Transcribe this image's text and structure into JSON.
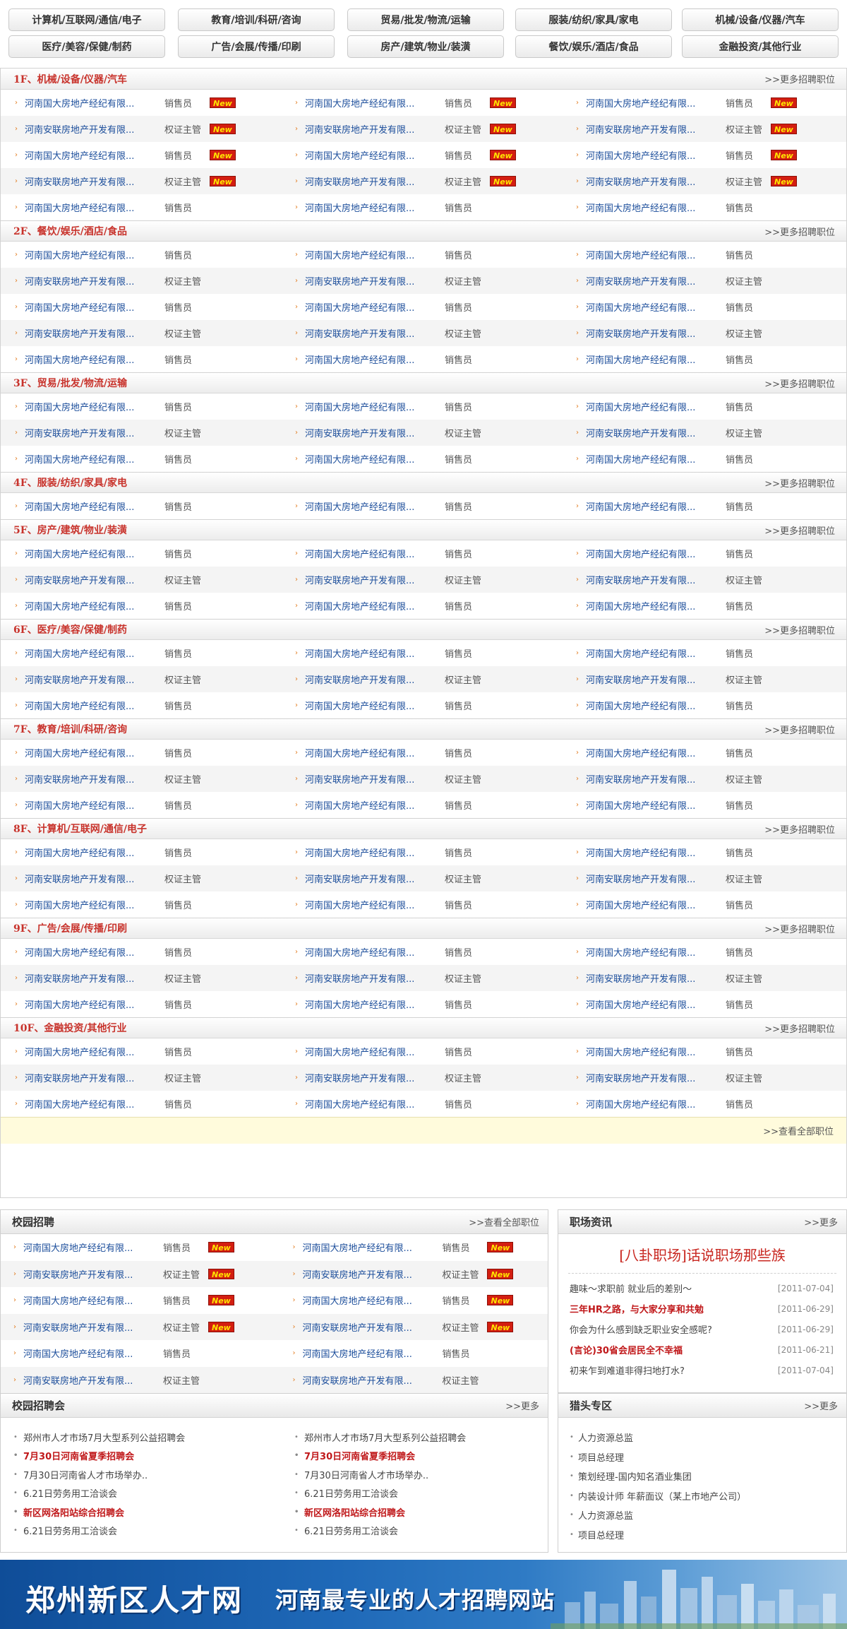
{
  "categories": [
    "计算机/互联网/通信/电子",
    "教育/培训/科研/咨询",
    "贸易/批发/物流/运输",
    "服装/纺织/家具/家电",
    "机械/设备/仪器/汽车",
    "医疗/美容/保健/制药",
    "广告/会展/传播/印刷",
    "房产/建筑/物业/装潢",
    "餐饮/娱乐/酒店/食品",
    "金融投资/其他行业"
  ],
  "labels": {
    "more_jobs": ">>更多招聘职位",
    "view_all_jobs": ">>查看全部职位",
    "view_all_campus": ">>查看全部职位",
    "more": ">>更多",
    "new_badge": "New",
    "arrow_glyph": "›",
    "dot_glyph": "•"
  },
  "floors": [
    {
      "title": "1F、机械/设备/仪器/汽车",
      "rows": [
        [
          {
            "company": "河南国大房地产经纪有限...",
            "position": "销售员",
            "new": true
          },
          {
            "company": "河南国大房地产经纪有限...",
            "position": "销售员",
            "new": true
          },
          {
            "company": "河南国大房地产经纪有限...",
            "position": "销售员",
            "new": true
          }
        ],
        [
          {
            "company": "河南安联房地产开发有限...",
            "position": "权证主管",
            "new": true
          },
          {
            "company": "河南安联房地产开发有限...",
            "position": "权证主管",
            "new": true
          },
          {
            "company": "河南安联房地产开发有限...",
            "position": "权证主管",
            "new": true
          }
        ],
        [
          {
            "company": "河南国大房地产经纪有限...",
            "position": "销售员",
            "new": true
          },
          {
            "company": "河南国大房地产经纪有限...",
            "position": "销售员",
            "new": true
          },
          {
            "company": "河南国大房地产经纪有限...",
            "position": "销售员",
            "new": true
          }
        ],
        [
          {
            "company": "河南安联房地产开发有限...",
            "position": "权证主管",
            "new": true
          },
          {
            "company": "河南安联房地产开发有限...",
            "position": "权证主管",
            "new": true
          },
          {
            "company": "河南安联房地产开发有限...",
            "position": "权证主管",
            "new": true
          }
        ],
        [
          {
            "company": "河南国大房地产经纪有限...",
            "position": "销售员",
            "new": false
          },
          {
            "company": "河南国大房地产经纪有限...",
            "position": "销售员",
            "new": false
          },
          {
            "company": "河南国大房地产经纪有限...",
            "position": "销售员",
            "new": false
          }
        ]
      ]
    },
    {
      "title": "2F、餐饮/娱乐/酒店/食品",
      "rows": [
        [
          {
            "company": "河南国大房地产经纪有限...",
            "position": "销售员",
            "new": false
          },
          {
            "company": "河南国大房地产经纪有限...",
            "position": "销售员",
            "new": false
          },
          {
            "company": "河南国大房地产经纪有限...",
            "position": "销售员",
            "new": false
          }
        ],
        [
          {
            "company": "河南安联房地产开发有限...",
            "position": "权证主管",
            "new": false
          },
          {
            "company": "河南安联房地产开发有限...",
            "position": "权证主管",
            "new": false
          },
          {
            "company": "河南安联房地产开发有限...",
            "position": "权证主管",
            "new": false
          }
        ],
        [
          {
            "company": "河南国大房地产经纪有限...",
            "position": "销售员",
            "new": false
          },
          {
            "company": "河南国大房地产经纪有限...",
            "position": "销售员",
            "new": false
          },
          {
            "company": "河南国大房地产经纪有限...",
            "position": "销售员",
            "new": false
          }
        ],
        [
          {
            "company": "河南安联房地产开发有限...",
            "position": "权证主管",
            "new": false
          },
          {
            "company": "河南安联房地产开发有限...",
            "position": "权证主管",
            "new": false
          },
          {
            "company": "河南安联房地产开发有限...",
            "position": "权证主管",
            "new": false
          }
        ],
        [
          {
            "company": "河南国大房地产经纪有限...",
            "position": "销售员",
            "new": false
          },
          {
            "company": "河南国大房地产经纪有限...",
            "position": "销售员",
            "new": false
          },
          {
            "company": "河南国大房地产经纪有限...",
            "position": "销售员",
            "new": false
          }
        ]
      ]
    },
    {
      "title": "3F、贸易/批发/物流/运输",
      "rows": [
        [
          {
            "company": "河南国大房地产经纪有限...",
            "position": "销售员",
            "new": false
          },
          {
            "company": "河南国大房地产经纪有限...",
            "position": "销售员",
            "new": false
          },
          {
            "company": "河南国大房地产经纪有限...",
            "position": "销售员",
            "new": false
          }
        ],
        [
          {
            "company": "河南安联房地产开发有限...",
            "position": "权证主管",
            "new": false
          },
          {
            "company": "河南安联房地产开发有限...",
            "position": "权证主管",
            "new": false
          },
          {
            "company": "河南安联房地产开发有限...",
            "position": "权证主管",
            "new": false
          }
        ],
        [
          {
            "company": "河南国大房地产经纪有限...",
            "position": "销售员",
            "new": false
          },
          {
            "company": "河南国大房地产经纪有限...",
            "position": "销售员",
            "new": false
          },
          {
            "company": "河南国大房地产经纪有限...",
            "position": "销售员",
            "new": false
          }
        ]
      ]
    },
    {
      "title": "4F、服装/纺织/家具/家电",
      "rows": [
        [
          {
            "company": "河南国大房地产经纪有限...",
            "position": "销售员",
            "new": false
          },
          {
            "company": "河南国大房地产经纪有限...",
            "position": "销售员",
            "new": false
          },
          {
            "company": "河南国大房地产经纪有限...",
            "position": "销售员",
            "new": false
          }
        ]
      ]
    },
    {
      "title": "5F、房产/建筑/物业/装潢",
      "rows": [
        [
          {
            "company": "河南国大房地产经纪有限...",
            "position": "销售员",
            "new": false
          },
          {
            "company": "河南国大房地产经纪有限...",
            "position": "销售员",
            "new": false
          },
          {
            "company": "河南国大房地产经纪有限...",
            "position": "销售员",
            "new": false
          }
        ],
        [
          {
            "company": "河南安联房地产开发有限...",
            "position": "权证主管",
            "new": false
          },
          {
            "company": "河南安联房地产开发有限...",
            "position": "权证主管",
            "new": false
          },
          {
            "company": "河南安联房地产开发有限...",
            "position": "权证主管",
            "new": false
          }
        ],
        [
          {
            "company": "河南国大房地产经纪有限...",
            "position": "销售员",
            "new": false
          },
          {
            "company": "河南国大房地产经纪有限...",
            "position": "销售员",
            "new": false
          },
          {
            "company": "河南国大房地产经纪有限...",
            "position": "销售员",
            "new": false
          }
        ]
      ]
    },
    {
      "title": "6F、医疗/美容/保健/制药",
      "rows": [
        [
          {
            "company": "河南国大房地产经纪有限...",
            "position": "销售员",
            "new": false
          },
          {
            "company": "河南国大房地产经纪有限...",
            "position": "销售员",
            "new": false
          },
          {
            "company": "河南国大房地产经纪有限...",
            "position": "销售员",
            "new": false
          }
        ],
        [
          {
            "company": "河南安联房地产开发有限...",
            "position": "权证主管",
            "new": false
          },
          {
            "company": "河南安联房地产开发有限...",
            "position": "权证主管",
            "new": false
          },
          {
            "company": "河南安联房地产开发有限...",
            "position": "权证主管",
            "new": false
          }
        ],
        [
          {
            "company": "河南国大房地产经纪有限...",
            "position": "销售员",
            "new": false
          },
          {
            "company": "河南国大房地产经纪有限...",
            "position": "销售员",
            "new": false
          },
          {
            "company": "河南国大房地产经纪有限...",
            "position": "销售员",
            "new": false
          }
        ]
      ]
    },
    {
      "title": "7F、教育/培训/科研/咨询",
      "rows": [
        [
          {
            "company": "河南国大房地产经纪有限...",
            "position": "销售员",
            "new": false
          },
          {
            "company": "河南国大房地产经纪有限...",
            "position": "销售员",
            "new": false
          },
          {
            "company": "河南国大房地产经纪有限...",
            "position": "销售员",
            "new": false
          }
        ],
        [
          {
            "company": "河南安联房地产开发有限...",
            "position": "权证主管",
            "new": false
          },
          {
            "company": "河南安联房地产开发有限...",
            "position": "权证主管",
            "new": false
          },
          {
            "company": "河南安联房地产开发有限...",
            "position": "权证主管",
            "new": false
          }
        ],
        [
          {
            "company": "河南国大房地产经纪有限...",
            "position": "销售员",
            "new": false
          },
          {
            "company": "河南国大房地产经纪有限...",
            "position": "销售员",
            "new": false
          },
          {
            "company": "河南国大房地产经纪有限...",
            "position": "销售员",
            "new": false
          }
        ]
      ]
    },
    {
      "title": "8F、计算机/互联网/通信/电子",
      "rows": [
        [
          {
            "company": "河南国大房地产经纪有限...",
            "position": "销售员",
            "new": false
          },
          {
            "company": "河南国大房地产经纪有限...",
            "position": "销售员",
            "new": false
          },
          {
            "company": "河南国大房地产经纪有限...",
            "position": "销售员",
            "new": false
          }
        ],
        [
          {
            "company": "河南安联房地产开发有限...",
            "position": "权证主管",
            "new": false
          },
          {
            "company": "河南安联房地产开发有限...",
            "position": "权证主管",
            "new": false
          },
          {
            "company": "河南安联房地产开发有限...",
            "position": "权证主管",
            "new": false
          }
        ],
        [
          {
            "company": "河南国大房地产经纪有限...",
            "position": "销售员",
            "new": false
          },
          {
            "company": "河南国大房地产经纪有限...",
            "position": "销售员",
            "new": false
          },
          {
            "company": "河南国大房地产经纪有限...",
            "position": "销售员",
            "new": false
          }
        ]
      ]
    },
    {
      "title": "9F、广告/会展/传播/印刷",
      "rows": [
        [
          {
            "company": "河南国大房地产经纪有限...",
            "position": "销售员",
            "new": false
          },
          {
            "company": "河南国大房地产经纪有限...",
            "position": "销售员",
            "new": false
          },
          {
            "company": "河南国大房地产经纪有限...",
            "position": "销售员",
            "new": false
          }
        ],
        [
          {
            "company": "河南安联房地产开发有限...",
            "position": "权证主管",
            "new": false
          },
          {
            "company": "河南安联房地产开发有限...",
            "position": "权证主管",
            "new": false
          },
          {
            "company": "河南安联房地产开发有限...",
            "position": "权证主管",
            "new": false
          }
        ],
        [
          {
            "company": "河南国大房地产经纪有限...",
            "position": "销售员",
            "new": false
          },
          {
            "company": "河南国大房地产经纪有限...",
            "position": "销售员",
            "new": false
          },
          {
            "company": "河南国大房地产经纪有限...",
            "position": "销售员",
            "new": false
          }
        ]
      ]
    },
    {
      "title": "10F、金融投资/其他行业",
      "rows": [
        [
          {
            "company": "河南国大房地产经纪有限...",
            "position": "销售员",
            "new": false
          },
          {
            "company": "河南国大房地产经纪有限...",
            "position": "销售员",
            "new": false
          },
          {
            "company": "河南国大房地产经纪有限...",
            "position": "销售员",
            "new": false
          }
        ],
        [
          {
            "company": "河南安联房地产开发有限...",
            "position": "权证主管",
            "new": false
          },
          {
            "company": "河南安联房地产开发有限...",
            "position": "权证主管",
            "new": false
          },
          {
            "company": "河南安联房地产开发有限...",
            "position": "权证主管",
            "new": false
          }
        ],
        [
          {
            "company": "河南国大房地产经纪有限...",
            "position": "销售员",
            "new": false
          },
          {
            "company": "河南国大房地产经纪有限...",
            "position": "销售员",
            "new": false
          },
          {
            "company": "河南国大房地产经纪有限...",
            "position": "销售员",
            "new": false
          }
        ]
      ]
    }
  ],
  "campus": {
    "title": "校园招聘",
    "rows": [
      [
        {
          "company": "河南国大房地产经纪有限...",
          "position": "销售员",
          "new": true
        },
        {
          "company": "河南国大房地产经纪有限...",
          "position": "销售员",
          "new": true
        }
      ],
      [
        {
          "company": "河南安联房地产开发有限...",
          "position": "权证主管",
          "new": true
        },
        {
          "company": "河南安联房地产开发有限...",
          "position": "权证主管",
          "new": true
        }
      ],
      [
        {
          "company": "河南国大房地产经纪有限...",
          "position": "销售员",
          "new": true
        },
        {
          "company": "河南国大房地产经纪有限...",
          "position": "销售员",
          "new": true
        }
      ],
      [
        {
          "company": "河南安联房地产开发有限...",
          "position": "权证主管",
          "new": true
        },
        {
          "company": "河南安联房地产开发有限...",
          "position": "权证主管",
          "new": true
        }
      ],
      [
        {
          "company": "河南国大房地产经纪有限...",
          "position": "销售员",
          "new": false
        },
        {
          "company": "河南国大房地产经纪有限...",
          "position": "销售员",
          "new": false
        }
      ],
      [
        {
          "company": "河南安联房地产开发有限...",
          "position": "权证主管",
          "new": false
        },
        {
          "company": "河南安联房地产开发有限...",
          "position": "权证主管",
          "new": false
        }
      ]
    ]
  },
  "fairs": {
    "title": "校园招聘会",
    "left": [
      {
        "text": "郑州市人才市场7月大型系列公益招聘会",
        "hot": false
      },
      {
        "text": "7月30日河南省夏季招聘会",
        "hot": true
      },
      {
        "text": "7月30日河南省人才市场举办..",
        "hot": false
      },
      {
        "text": "6.21日劳务用工洽谈会",
        "hot": false
      },
      {
        "text": "新区网洛阳站综合招聘会",
        "hot": true
      },
      {
        "text": "6.21日劳务用工洽谈会",
        "hot": false
      }
    ],
    "right": [
      {
        "text": "郑州市人才市场7月大型系列公益招聘会",
        "hot": false
      },
      {
        "text": "7月30日河南省夏季招聘会",
        "hot": true
      },
      {
        "text": "7月30日河南省人才市场举办..",
        "hot": false
      },
      {
        "text": "6.21日劳务用工洽谈会",
        "hot": false
      },
      {
        "text": "新区网洛阳站综合招聘会",
        "hot": true
      },
      {
        "text": "6.21日劳务用工洽谈会",
        "hot": false
      }
    ]
  },
  "news": {
    "title": "职场资讯",
    "headline": "[八卦职场]话说职场那些族",
    "items": [
      {
        "text": "趣味～求职前 就业后的差别～",
        "date": "[2011-07-04]",
        "hot": false
      },
      {
        "text": "三年HR之路，与大家分享和共勉",
        "date": "[2011-06-29]",
        "hot": true
      },
      {
        "text": "你会为什么感到缺乏职业安全感呢?",
        "date": "[2011-06-29]",
        "hot": false
      },
      {
        "text": "(言论)30省会居民全不幸福",
        "date": "[2011-06-21]",
        "hot": true
      },
      {
        "text": "初来乍到难道非得扫地打水?",
        "date": "[2011-07-04]",
        "hot": false
      }
    ]
  },
  "hunter": {
    "title": "猎头专区",
    "items": [
      "人力资源总监",
      "项目总经理",
      "策划经理-国内知名酒业集团",
      "内装设计师 年薪面议（某上市地产公司）",
      "人力资源总监",
      "项目总经理"
    ]
  },
  "banner": {
    "site_name": "郑州新区人才网",
    "slogan": "河南最专业的人才招聘网站"
  },
  "colors": {
    "floor_title": "#c8332c",
    "company_link": "#1c4e9b",
    "hot_text": "#c0181a",
    "new_badge_bg": "#d31e11",
    "new_badge_text": "#ffe400",
    "banner_blue": "#1f69b8"
  }
}
